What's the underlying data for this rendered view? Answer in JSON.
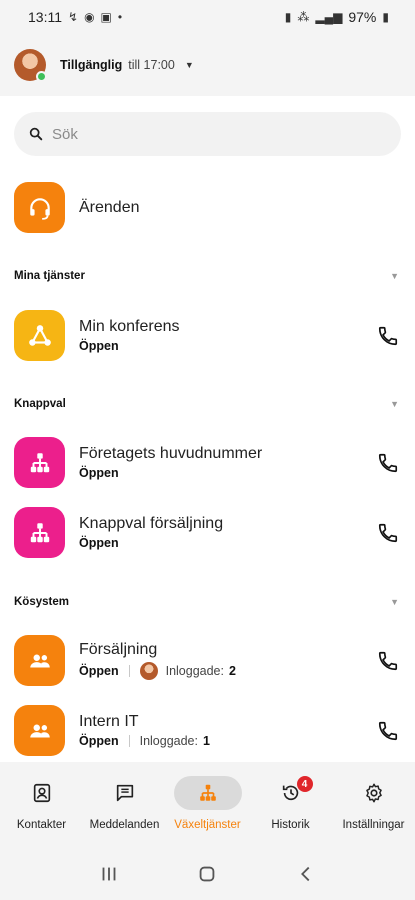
{
  "status_bar": {
    "time": "13:11",
    "battery": "97%"
  },
  "header": {
    "availability_label": "Tillgänglig",
    "availability_until": "till 17:00"
  },
  "search": {
    "placeholder": "Sök"
  },
  "cases": {
    "title": "Ärenden"
  },
  "sections": [
    {
      "title": "Mina tjänster"
    },
    {
      "title": "Knappval"
    },
    {
      "title": "Kösystem"
    }
  ],
  "services": [
    {
      "title": "Min konferens",
      "status": "Öppen"
    }
  ],
  "button_choices": [
    {
      "title": "Företagets huvudnummer",
      "status": "Öppen"
    },
    {
      "title": "Knappval försäljning",
      "status": "Öppen"
    }
  ],
  "queues": [
    {
      "title": "Försäljning",
      "status": "Öppen",
      "logged_in_label": "Inloggade:",
      "logged_in_count": "2"
    },
    {
      "title": "Intern IT",
      "status": "Öppen",
      "logged_in_label": "Inloggade:",
      "logged_in_count": "1"
    }
  ],
  "bottom_nav": [
    {
      "label": "Kontakter",
      "icon": "contact-card-icon"
    },
    {
      "label": "Meddelanden",
      "icon": "message-icon"
    },
    {
      "label": "Växeltjänster",
      "icon": "org-tree-icon",
      "active": true
    },
    {
      "label": "Historik",
      "icon": "history-icon",
      "badge": "4"
    },
    {
      "label": "Inställningar",
      "icon": "gear-icon"
    }
  ],
  "colors": {
    "accent": "#f5820d",
    "yellow": "#f6b514",
    "pink": "#ec1f8c",
    "badge": "#e0262b",
    "online": "#3fbf5a"
  }
}
